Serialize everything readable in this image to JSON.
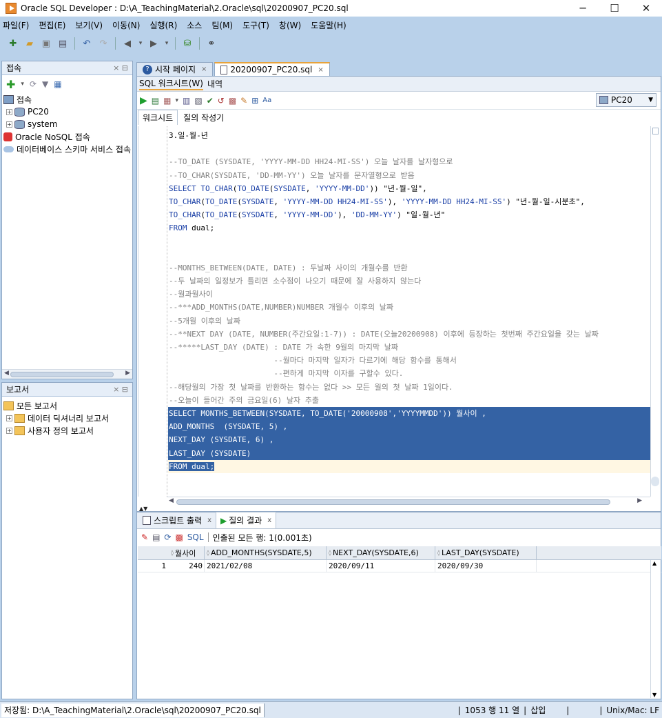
{
  "window": {
    "title": "Oracle SQL Developer : D:\\A_TeachingMaterial\\2.Oracle\\sql\\20200907_PC20.sql",
    "min": "─",
    "max": "☐",
    "close": "✕"
  },
  "menu": [
    "파일(F)",
    "편집(E)",
    "보기(V)",
    "이동(N)",
    "실행(R)",
    "소스",
    "팀(M)",
    "도구(T)",
    "창(W)",
    "도움말(H)"
  ],
  "connections_panel": {
    "title": "접속",
    "tree": [
      {
        "label": "접속",
        "level": 0
      },
      {
        "label": "PC20",
        "level": 1
      },
      {
        "label": "system",
        "level": 1
      },
      {
        "label": "Oracle NoSQL 접속",
        "level": 0
      },
      {
        "label": "데이터베이스 스키마 서비스 접속",
        "level": 0
      }
    ]
  },
  "reports_panel": {
    "title": "보고서",
    "tree": [
      {
        "label": "모든 보고서",
        "level": 0
      },
      {
        "label": "데이터 딕셔너리 보고서",
        "level": 1
      },
      {
        "label": "사용자 정의 보고서",
        "level": 1
      }
    ]
  },
  "editor_tabs": [
    {
      "label": "시작 페이지"
    },
    {
      "label": "20200907_PC20.sql"
    }
  ],
  "sub_tabs": [
    "SQL 워크시트(W)",
    "내역"
  ],
  "connection_select": "PC20",
  "worksheet_tabs": [
    "워크시트",
    "질의 작성기"
  ],
  "code_lines": [
    {
      "t": "3.일-월-년",
      "c": "plain"
    },
    {
      "t": "",
      "c": "plain"
    },
    {
      "t": "--TO_DATE (SYSDATE, 'YYYY-MM-DD HH24-MI-SS') 오늘 날자를 날자형으로",
      "c": "cm"
    },
    {
      "t": "--TO_CHAR(SYSDATE, 'DD-MM-YY') 오늘 날자를 문자열형으로 받음",
      "c": "cm"
    },
    {
      "t": "SELECT TO_CHAR(TO_DATE(SYSDATE, 'YYYY-MM-DD')) \"년-월-일\",",
      "c": "code"
    },
    {
      "t": "TO_CHAR(TO_DATE(SYSDATE, 'YYYY-MM-DD HH24-MI-SS'), 'YYYY-MM-DD HH24-MI-SS') \"년-월-일-시분초\",",
      "c": "code"
    },
    {
      "t": "TO_CHAR(TO_DATE(SYSDATE, 'YYYY-MM-DD'), 'DD-MM-YY') \"일-월-년\"",
      "c": "code"
    },
    {
      "t": "FROM dual;",
      "c": "code"
    },
    {
      "t": "",
      "c": "plain"
    },
    {
      "t": "",
      "c": "plain"
    },
    {
      "t": "--MONTHS_BETWEEN(DATE, DATE) : 두날짜 사이의 개월수를 반환",
      "c": "cm"
    },
    {
      "t": "--두 날짜의 일정보가 틀리면 소수점이 나오기 때문에 잘 사용하지 않는다",
      "c": "cm"
    },
    {
      "t": "--월과월사이",
      "c": "cm"
    },
    {
      "t": "--***ADD_MONTHS(DATE,NUMBER)NUMBER 개월수 이후의 날짜",
      "c": "cm"
    },
    {
      "t": "--5개월 이후의 날짜",
      "c": "cm"
    },
    {
      "t": "--**NEXT DAY (DATE, NUMBER(주간요일:1-7)) : DATE(오늘20200908) 이후에 등장하는 첫번째 주간요일을 갖는 날짜",
      "c": "cm"
    },
    {
      "t": "--*****LAST_DAY (DATE) : DATE 가 속한 9월의 마지막 날짜",
      "c": "cm"
    },
    {
      "t": "                       --월마다 마지막 일자가 다르기에 해당 함수를 통해서",
      "c": "cm"
    },
    {
      "t": "                       --편하게 마지막 이자를 구할수 있다.",
      "c": "cm"
    },
    {
      "t": "--해당월의 가장 첫 날짜를 반환하는 함수는 없다 >> 모든 월의 첫 날짜 1일이다.",
      "c": "cm"
    },
    {
      "t": "--오늘이 들어간 주의 금요일(6) 날자 추출",
      "c": "cm"
    },
    {
      "t": "SELECT MONTHS_BETWEEN(SYSDATE, TO_DATE('20000908','YYYYMMDD')) 월사이 ,",
      "c": "sel"
    },
    {
      "t": "ADD_MONTHS  (SYSDATE, 5) ,",
      "c": "sel"
    },
    {
      "t": "NEXT_DAY (SYSDATE, 6) ,",
      "c": "sel"
    },
    {
      "t": "LAST_DAY (SYSDATE)",
      "c": "sel"
    },
    {
      "t": "FROM dual;",
      "c": "selcur"
    }
  ],
  "output_tabs": [
    {
      "label": "스크립트 출력"
    },
    {
      "label": "질의 결과"
    }
  ],
  "output_toolbar": {
    "sql": "SQL",
    "status": "인출된 모든 행: 1(0.001초)"
  },
  "result": {
    "columns": [
      "월사이",
      "ADD_MONTHS(SYSDATE,5)",
      "NEXT_DAY(SYSDATE,6)",
      "LAST_DAY(SYSDATE)"
    ],
    "rows": [
      {
        "n": "1",
        "cells": [
          "240",
          "2021/02/08",
          "2020/09/11",
          "2020/09/30"
        ]
      }
    ]
  },
  "statusbar": {
    "path": "저장됨: D:\\A_TeachingMaterial\\2.Oracle\\sql\\20200907_PC20.sql",
    "position": "1053 행 11 열",
    "mode": "삽입",
    "eol": "Unix/Mac: LF"
  }
}
